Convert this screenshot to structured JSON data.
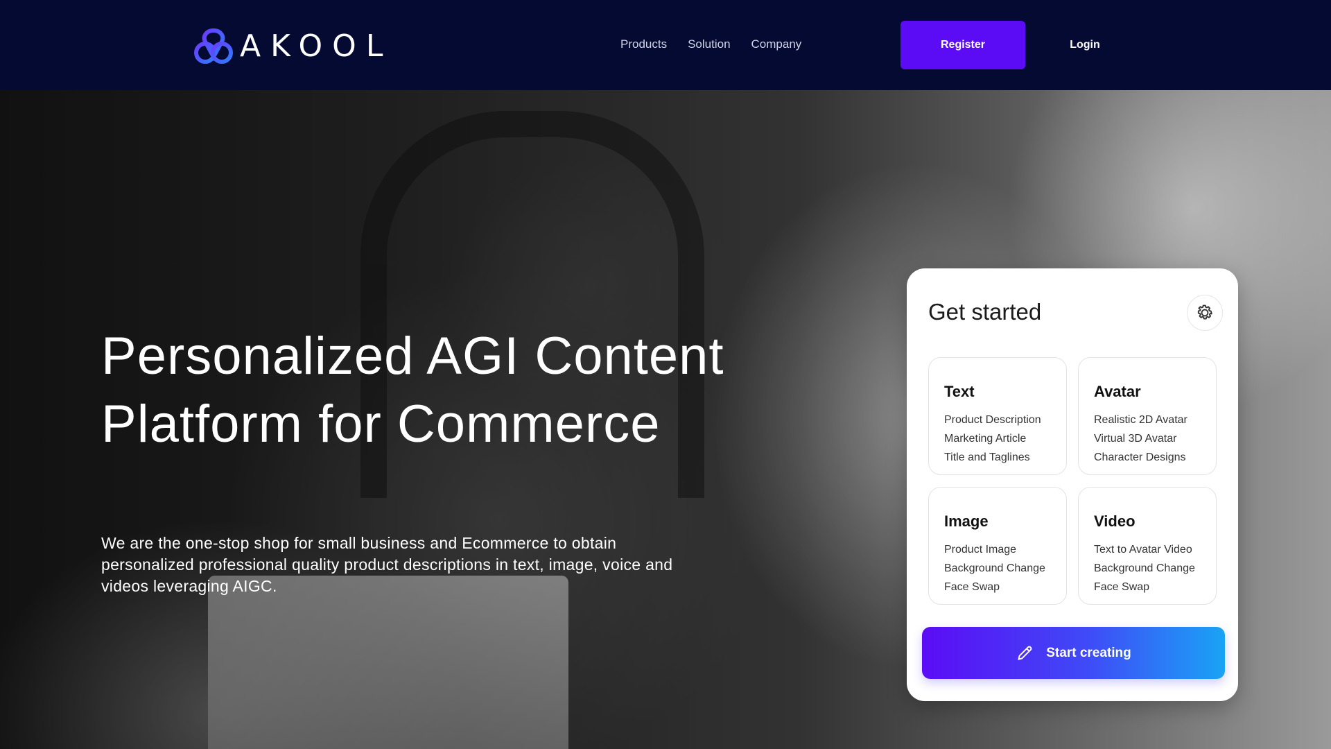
{
  "brand": {
    "name": "AKOOL",
    "icon": "akool-logo-mark"
  },
  "nav": {
    "items": [
      "Products",
      "Solution",
      "Company"
    ],
    "register_label": "Register",
    "login_label": "Login"
  },
  "hero": {
    "headline_line1": "Personalized AGI Content",
    "headline_line2": "Platform for Commerce",
    "subtext": "We are the one-stop shop for small business and Ecommerce to obtain personalized professional quality product descriptions in text, image, voice and videos leveraging AIGC."
  },
  "card": {
    "title": "Get started",
    "settings_icon": "gear-icon",
    "tiles": [
      {
        "title": "Text",
        "items": [
          "Product Description",
          "Marketing Article",
          "Title and Taglines"
        ]
      },
      {
        "title": "Avatar",
        "items": [
          "Realistic 2D Avatar",
          "Virtual 3D Avatar",
          "Character Designs"
        ]
      },
      {
        "title": "Image",
        "items": [
          "Product Image",
          "Background Change",
          "Face Swap"
        ]
      },
      {
        "title": "Video",
        "items": [
          "Text to Avatar Video",
          "Background Change",
          "Face Swap"
        ]
      }
    ],
    "start_label": "Start creating",
    "start_icon": "pencil-icon"
  },
  "colors": {
    "header_bg": "#050a33",
    "accent": "#5b0cf5",
    "gradient_end": "#1aa3f5",
    "logo_blue": "#3d6bff"
  }
}
